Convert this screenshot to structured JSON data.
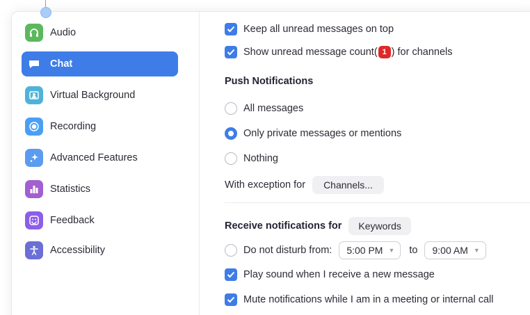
{
  "sidebar": {
    "items": [
      {
        "label": "Audio",
        "icon": "headphones-icon",
        "color": "#5cb85c",
        "active": false
      },
      {
        "label": "Chat",
        "icon": "chat-bubble-icon",
        "color": "#3e7de7",
        "active": true
      },
      {
        "label": "Virtual Background",
        "icon": "person-portrait-icon",
        "color": "#4fb3d9",
        "active": false
      },
      {
        "label": "Recording",
        "icon": "record-icon",
        "color": "#4a9ff5",
        "active": false
      },
      {
        "label": "Advanced Features",
        "icon": "sparkles-icon",
        "color": "#5b9cf0",
        "active": false
      },
      {
        "label": "Statistics",
        "icon": "bar-chart-icon",
        "color": "#a35fd1",
        "active": false
      },
      {
        "label": "Feedback",
        "icon": "smiley-icon",
        "color": "#8d5ee8",
        "active": false
      },
      {
        "label": "Accessibility",
        "icon": "accessibility-icon",
        "color": "#6b6fd6",
        "active": false
      }
    ]
  },
  "settings": {
    "keep_unread_top": {
      "label": "Keep all unread messages on top",
      "checked": true
    },
    "show_unread_count": {
      "label_before": "Show unread message count(",
      "badge": "1",
      "label_after": ") for channels",
      "checked": true
    },
    "push_heading": "Push Notifications",
    "push_options": [
      {
        "label": "All messages",
        "selected": false
      },
      {
        "label": "Only private messages or mentions",
        "selected": true
      },
      {
        "label": "Nothing",
        "selected": false
      }
    ],
    "exception_label": "With exception for",
    "channels_button": "Channels...",
    "receive_heading": "Receive notifications for",
    "keywords_button": "Keywords",
    "dnd": {
      "label": "Do not disturb from:",
      "checked": false,
      "from": "5:00 PM",
      "to_label": "to",
      "to": "9:00 AM"
    },
    "play_sound": {
      "label": "Play sound when I receive a new message",
      "checked": true
    },
    "mute_notifications": {
      "label": "Mute notifications while I am in a meeting or internal call",
      "checked": true
    }
  },
  "colors": {
    "accent": "#3e7de7",
    "badge": "#e02828"
  }
}
